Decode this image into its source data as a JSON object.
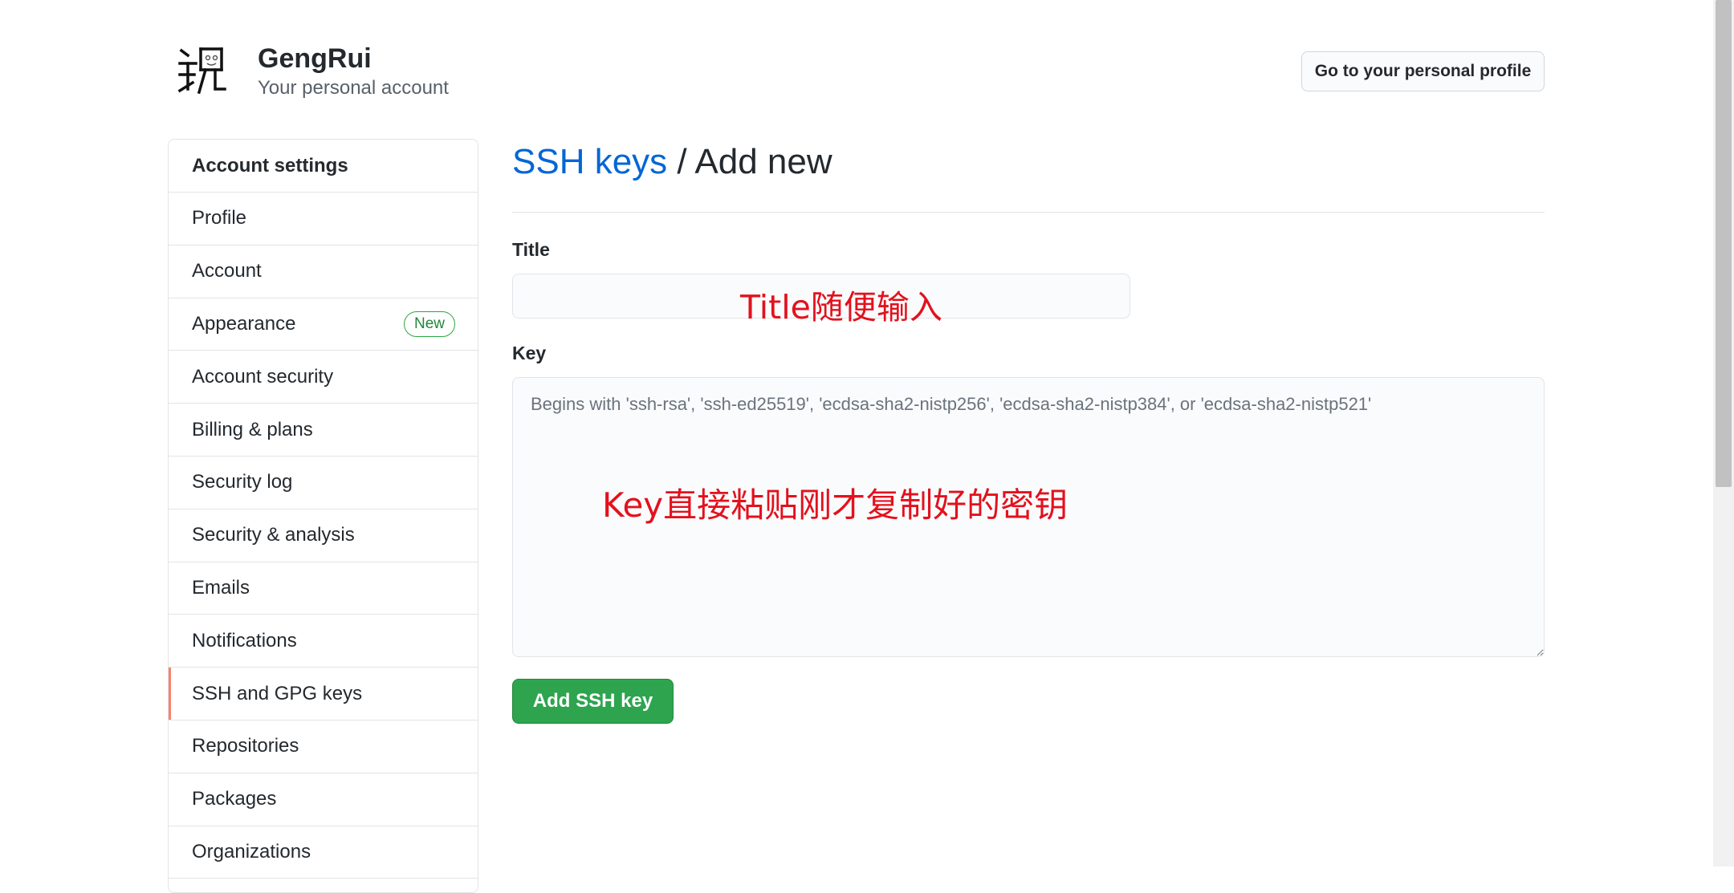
{
  "header": {
    "account_name": "GengRui",
    "account_subtitle": "Your personal account",
    "profile_button": "Go to your personal profile"
  },
  "sidebar": {
    "heading": "Account settings",
    "items": [
      {
        "label": "Profile"
      },
      {
        "label": "Account"
      },
      {
        "label": "Appearance",
        "badge": "New"
      },
      {
        "label": "Account security"
      },
      {
        "label": "Billing & plans"
      },
      {
        "label": "Security log"
      },
      {
        "label": "Security & analysis"
      },
      {
        "label": "Emails"
      },
      {
        "label": "Notifications"
      },
      {
        "label": "SSH and GPG keys",
        "selected": true
      },
      {
        "label": "Repositories"
      },
      {
        "label": "Packages"
      },
      {
        "label": "Organizations"
      }
    ]
  },
  "main": {
    "breadcrumb_link": "SSH keys",
    "breadcrumb_rest": " / Add new",
    "title_label": "Title",
    "title_value": "",
    "key_label": "Key",
    "key_value": "",
    "key_placeholder": "Begins with 'ssh-rsa', 'ssh-ed25519', 'ecdsa-sha2-nistp256', 'ecdsa-sha2-nistp384', or 'ecdsa-sha2-nistp521'",
    "submit_button": "Add SSH key"
  },
  "annotations": {
    "title_note": "Title随便输入",
    "key_note": "Key直接粘贴刚才复制好的密钥"
  },
  "colors": {
    "link": "#0366d6",
    "primary_button": "#2ea44f",
    "selected_indicator": "#f9826c",
    "annotation": "#e3111d"
  }
}
